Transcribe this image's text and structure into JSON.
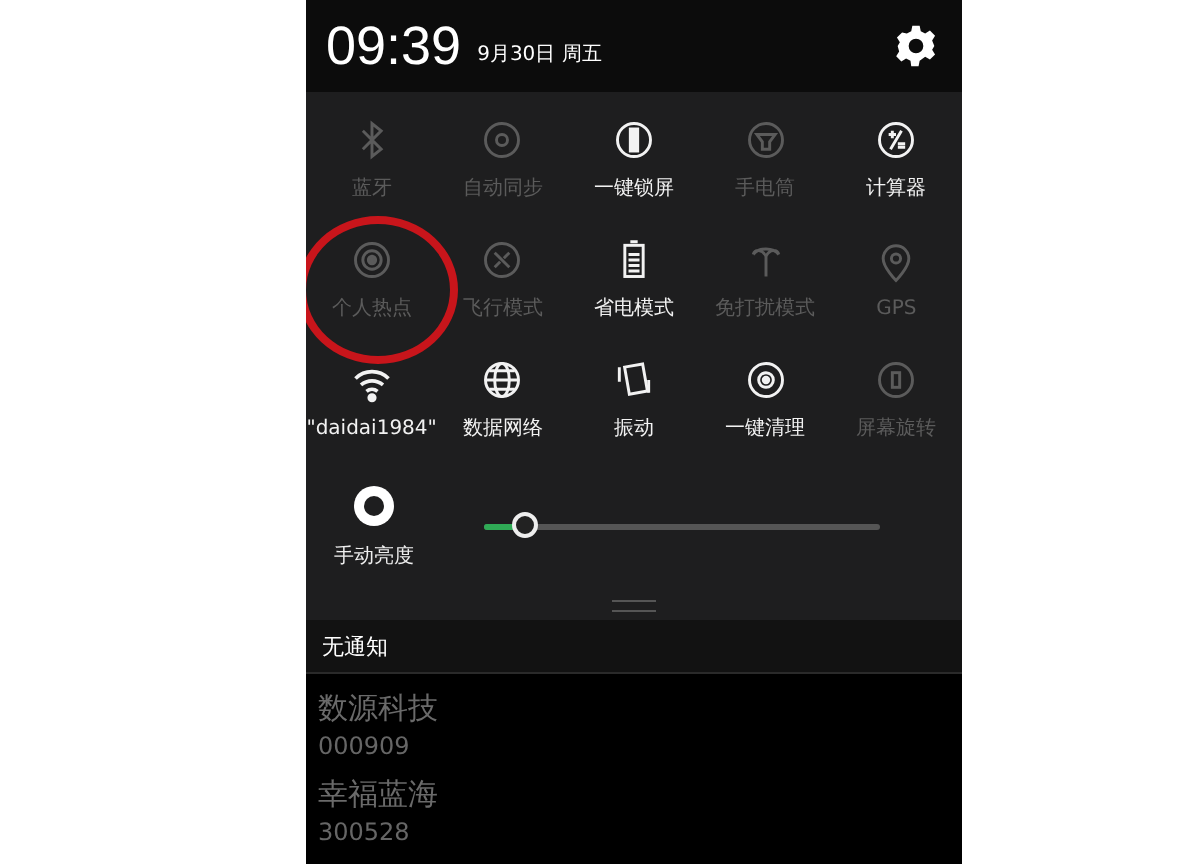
{
  "status": {
    "time": "09:39",
    "date": "9月30日 周五"
  },
  "tiles": [
    {
      "label": "蓝牙",
      "on": false
    },
    {
      "label": "自动同步",
      "on": false
    },
    {
      "label": "一键锁屏",
      "on": true
    },
    {
      "label": "手电筒",
      "on": false
    },
    {
      "label": "计算器",
      "on": true
    },
    {
      "label": "个人热点",
      "on": false
    },
    {
      "label": "飞行模式",
      "on": false
    },
    {
      "label": "省电模式",
      "on": true
    },
    {
      "label": "免打扰模式",
      "on": false
    },
    {
      "label": "GPS",
      "on": false
    },
    {
      "label": "\"daidai1984\"",
      "on": true
    },
    {
      "label": "数据网络",
      "on": true
    },
    {
      "label": "振动",
      "on": true
    },
    {
      "label": "一键清理",
      "on": true
    },
    {
      "label": "屏幕旋转",
      "on": false
    }
  ],
  "brightness": {
    "label": "手动亮度",
    "level": 0.1
  },
  "notifications": {
    "empty_text": "无通知"
  },
  "background_list": [
    {
      "name": "数源科技",
      "code": "000909"
    },
    {
      "name": "幸福蓝海",
      "code": "300528"
    }
  ]
}
